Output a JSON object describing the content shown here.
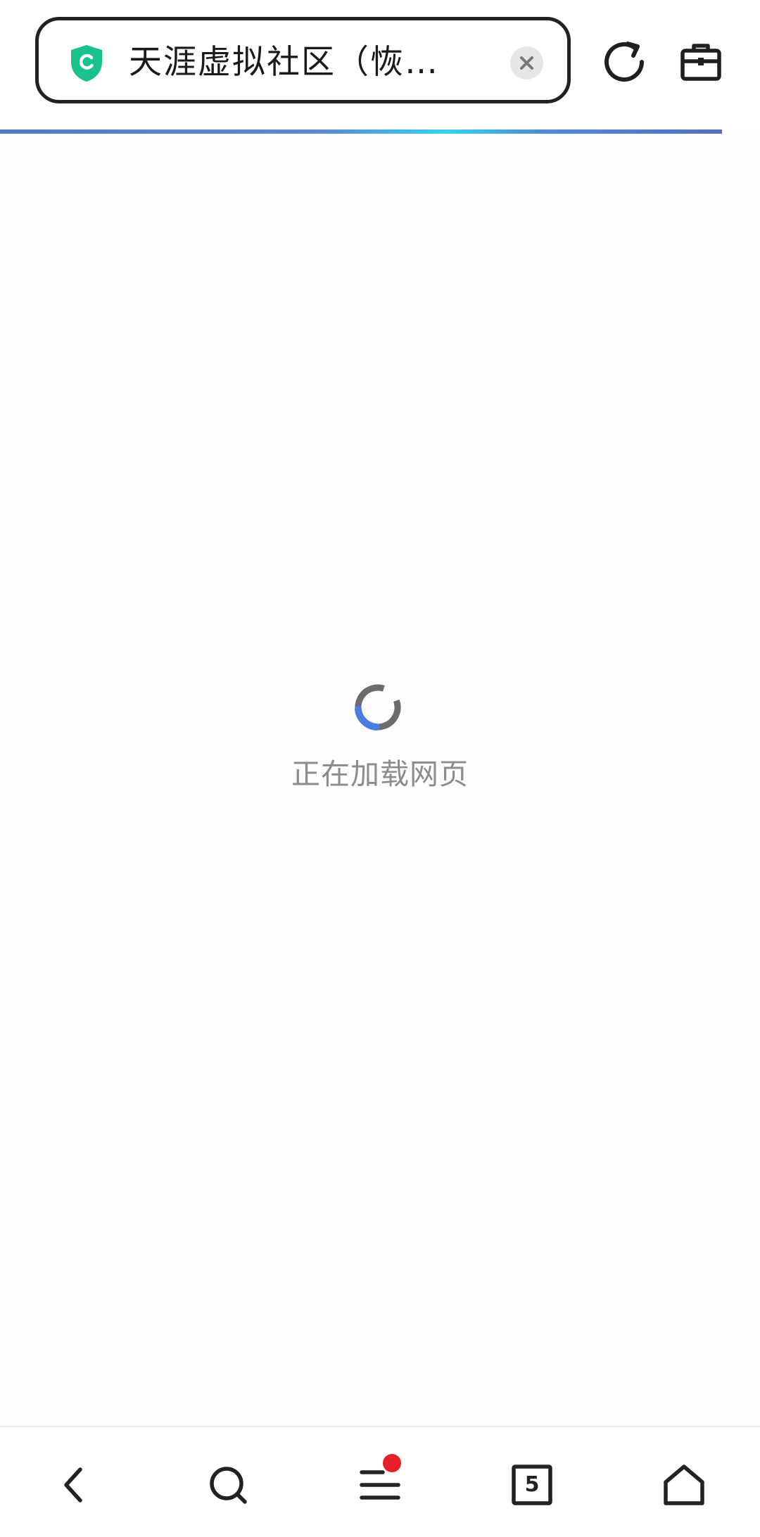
{
  "address_bar": {
    "title": "天涯虚拟社区（恢…",
    "security_icon": "shield-c-icon",
    "clear_icon": "close-icon",
    "refresh_icon": "refresh-icon",
    "toolbox_icon": "toolbox-icon",
    "load_progress": 0.95
  },
  "loading": {
    "text": "正在加载网页",
    "icon": "spinner-icon"
  },
  "bottom_nav": {
    "back_icon": "chevron-left-icon",
    "search_icon": "search-icon",
    "menu_icon": "menu-icon",
    "menu_has_notification": true,
    "tabs_count": "5",
    "home_icon": "home-icon"
  },
  "colors": {
    "shield": "#19c28a",
    "progress_start": "#4f79c9",
    "progress_highlight": "#35d4e6",
    "spinner_accent": "#4a7ee0",
    "spinner_track": "#6b6b6b",
    "notification_dot": "#e8202a"
  }
}
